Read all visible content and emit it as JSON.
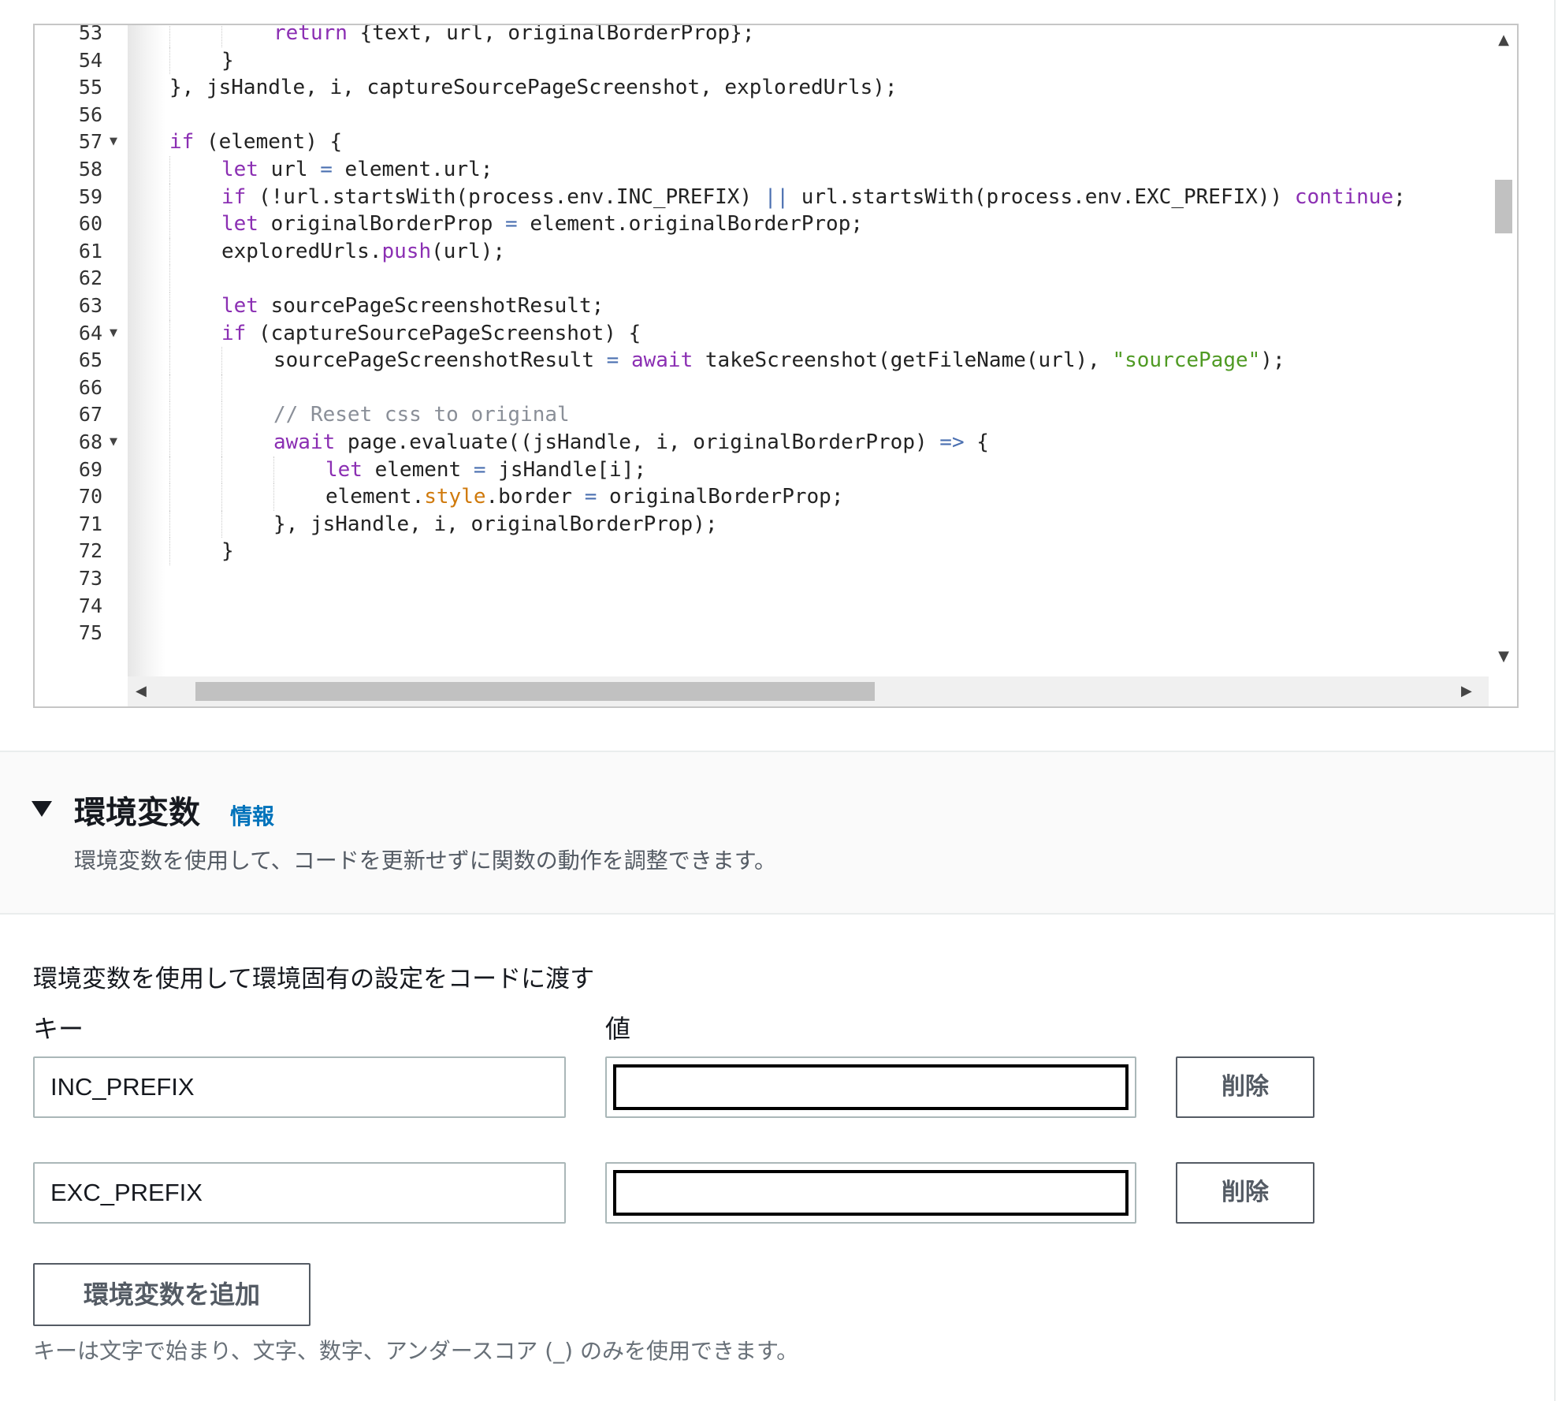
{
  "editor": {
    "lines": [
      {
        "n": "53",
        "fold": false,
        "indent": 2,
        "tokens": [
          [
            "kw",
            "return"
          ],
          [
            "t",
            " {text, url, originalBorderProp};"
          ]
        ]
      },
      {
        "n": "54",
        "fold": false,
        "indent": 1,
        "tokens": [
          [
            "t",
            "}"
          ]
        ]
      },
      {
        "n": "55",
        "fold": false,
        "indent": 0,
        "tokens": [
          [
            "t",
            "}, jsHandle, i, captureSourcePageScreenshot, exploredUrls);"
          ]
        ]
      },
      {
        "n": "56",
        "fold": false,
        "indent": 0,
        "tokens": []
      },
      {
        "n": "57",
        "fold": true,
        "indent": 0,
        "tokens": [
          [
            "kw",
            "if"
          ],
          [
            "t",
            " (element) {"
          ]
        ]
      },
      {
        "n": "58",
        "fold": false,
        "indent": 1,
        "tokens": [
          [
            "kw",
            "let"
          ],
          [
            "t",
            " url "
          ],
          [
            "op",
            "="
          ],
          [
            "t",
            " element.url;"
          ]
        ]
      },
      {
        "n": "59",
        "fold": false,
        "indent": 1,
        "tokens": [
          [
            "kw",
            "if"
          ],
          [
            "t",
            " (!url.startsWith(process.env.INC_PREFIX) "
          ],
          [
            "op",
            "||"
          ],
          [
            "t",
            " url.startsWith(process.env.EXC_PREFIX)) "
          ],
          [
            "kw",
            "continue"
          ],
          [
            "t",
            ";"
          ]
        ]
      },
      {
        "n": "60",
        "fold": false,
        "indent": 1,
        "tokens": [
          [
            "kw",
            "let"
          ],
          [
            "t",
            " originalBorderProp "
          ],
          [
            "op",
            "="
          ],
          [
            "t",
            " element.originalBorderProp;"
          ]
        ]
      },
      {
        "n": "61",
        "fold": false,
        "indent": 1,
        "tokens": [
          [
            "t",
            "exploredUrls."
          ],
          [
            "fn",
            "push"
          ],
          [
            "t",
            "(url);"
          ]
        ]
      },
      {
        "n": "62",
        "fold": false,
        "indent": 1,
        "tokens": []
      },
      {
        "n": "63",
        "fold": false,
        "indent": 1,
        "tokens": [
          [
            "kw",
            "let"
          ],
          [
            "t",
            " sourcePageScreenshotResult;"
          ]
        ]
      },
      {
        "n": "64",
        "fold": true,
        "indent": 1,
        "tokens": [
          [
            "kw",
            "if"
          ],
          [
            "t",
            " (captureSourcePageScreenshot) {"
          ]
        ]
      },
      {
        "n": "65",
        "fold": false,
        "indent": 2,
        "tokens": [
          [
            "t",
            "sourcePageScreenshotResult "
          ],
          [
            "op",
            "="
          ],
          [
            "t",
            " "
          ],
          [
            "kw",
            "await"
          ],
          [
            "t",
            " takeScreenshot(getFileName(url), "
          ],
          [
            "str",
            "\"sourcePage\""
          ],
          [
            "t",
            ");"
          ]
        ]
      },
      {
        "n": "66",
        "fold": false,
        "indent": 2,
        "tokens": []
      },
      {
        "n": "67",
        "fold": false,
        "indent": 2,
        "tokens": [
          [
            "cm",
            "// Reset css to original"
          ]
        ]
      },
      {
        "n": "68",
        "fold": true,
        "indent": 2,
        "tokens": [
          [
            "kw",
            "await"
          ],
          [
            "t",
            " page.evaluate((jsHandle, i, originalBorderProp) "
          ],
          [
            "op",
            "=>"
          ],
          [
            "t",
            " {"
          ]
        ]
      },
      {
        "n": "69",
        "fold": false,
        "indent": 3,
        "tokens": [
          [
            "kw",
            "let"
          ],
          [
            "t",
            " element "
          ],
          [
            "op",
            "="
          ],
          [
            "t",
            " jsHandle[i];"
          ]
        ]
      },
      {
        "n": "70",
        "fold": false,
        "indent": 3,
        "tokens": [
          [
            "t",
            "element."
          ],
          [
            "prop",
            "style"
          ],
          [
            "t",
            ".border "
          ],
          [
            "op",
            "="
          ],
          [
            "t",
            " originalBorderProp;"
          ]
        ]
      },
      {
        "n": "71",
        "fold": false,
        "indent": 2,
        "tokens": [
          [
            "t",
            "}, jsHandle, i, originalBorderProp);"
          ]
        ]
      },
      {
        "n": "72",
        "fold": false,
        "indent": 1,
        "tokens": [
          [
            "t",
            "}"
          ]
        ]
      },
      {
        "n": "73",
        "fold": false,
        "indent": 0,
        "tokens": []
      },
      {
        "n": "74",
        "fold": false,
        "indent": 0,
        "tokens": []
      },
      {
        "n": "75",
        "fold": false,
        "indent": 0,
        "tokens": []
      }
    ]
  },
  "env_section": {
    "title": "環境変数",
    "info_link": "情報",
    "description": "環境変数を使用して、コードを更新せずに関数の動作を調整できます。"
  },
  "env_form": {
    "description": "環境変数を使用して環境固有の設定をコードに渡す",
    "key_label": "キー",
    "value_label": "値",
    "rows": [
      {
        "key": "INC_PREFIX",
        "value": "",
        "remove_label": "削除"
      },
      {
        "key": "EXC_PREFIX",
        "value": "",
        "remove_label": "削除"
      }
    ],
    "add_button_label": "環境変数を追加",
    "hint": "キーは文字で始まり、文字、数字、アンダースコア (_) のみを使用できます。"
  },
  "colors": {
    "keyword": "#8b2fb3",
    "string": "#4f9a23",
    "property": "#d07a0c",
    "operator": "#4a6fb0",
    "comment": "#8a8f98",
    "link": "#0073bb"
  }
}
